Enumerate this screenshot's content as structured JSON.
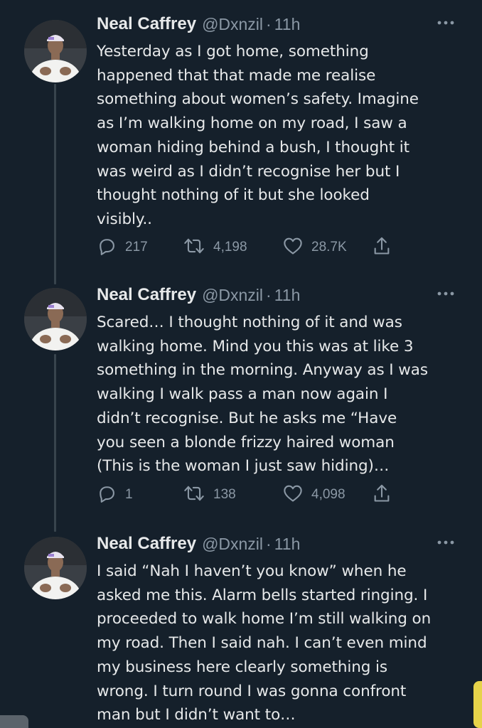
{
  "tweets": [
    {
      "name": "Neal Caffrey",
      "handle": "@Dxnzil",
      "separator": "·",
      "time": "11h",
      "lines": [
        "Yesterday as I got home, something",
        "happened that that made me realise",
        "something about women’s safety. Imagine",
        "as I’m walking home on my road, I saw a",
        "woman hiding behind a bush, I thought it",
        "was weird as I didn’t recognise her but I",
        "thought nothing of it but she looked",
        "visibly.."
      ],
      "replies": "217",
      "retweets": "4,198",
      "likes": "28.7K"
    },
    {
      "name": "Neal Caffrey",
      "handle": "@Dxnzil",
      "separator": "·",
      "time": "11h",
      "lines": [
        "Scared… I thought nothing of it and was",
        "walking home. Mind you this was at like 3",
        "something in the morning. Anyway as I was",
        "walking I walk pass a man now again I",
        "didn’t recognise. But he asks me “Have",
        "you seen a blonde frizzy haired woman",
        "(This is the woman I just saw hiding)…"
      ],
      "replies": "1",
      "retweets": "138",
      "likes": "4,098"
    },
    {
      "name": "Neal Caffrey",
      "handle": "@Dxnzil",
      "separator": "·",
      "time": "11h",
      "lines": [
        "I said “Nah I haven’t you know” when he",
        "asked me this. Alarm bells started ringing. I",
        "proceeded to walk home I’m still walking on",
        "my road. Then I said nah. I can’t even mind",
        "my business here clearly something is",
        "wrong. I turn round I was gonna confront",
        "man but I didn’t want to…"
      ]
    }
  ],
  "icons": {
    "reply": "reply-icon",
    "retweet": "retweet-icon",
    "like": "heart-icon",
    "share": "share-icon",
    "more": "more-icon"
  },
  "colors": {
    "background": "#15202b",
    "text": "#e7e9ea",
    "secondary": "#8b98a5",
    "thread_line": "#38444d"
  }
}
